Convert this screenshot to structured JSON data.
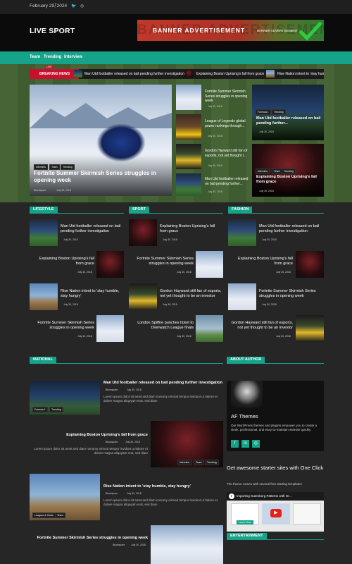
{
  "topbar": {
    "date": "February 29, 2024",
    "social_icons": [
      "facebook-icon",
      "twitter-icon",
      "instagram-icon"
    ]
  },
  "header": {
    "logo": "LIVE SPORT",
    "banner_title": "BANNER ADVERTISEMENT",
    "banner_small": "BANNER ADVERTISEMENT"
  },
  "nav": {
    "items": [
      "Team",
      "Trending",
      "Interview"
    ]
  },
  "ticker": {
    "label": "BREAKING NEWS",
    "live": "LIVE",
    "items": [
      "Man Utd footballer released on bail pending further investigation",
      "Explaining Boston Uprising's fall from grace",
      "Rise Nation intent to 'stay humble, stay hungry'"
    ]
  },
  "hero": {
    "tags": [
      "Interview",
      "Team",
      "Trending"
    ],
    "title": "Fortnite Summer Skirmish Series struggles in opening week",
    "author": "Blockspare",
    "date": "July 30, 2018"
  },
  "mid_list": [
    {
      "title": "Fortnite Summer Skirmish Series struggles in opening week",
      "date": "July 30, 2018"
    },
    {
      "title": "League of Legends global power rankings through...",
      "date": "July 30, 2018"
    },
    {
      "title": "Gordon Hayward still fan of esports, not yet thought t...",
      "date": "July 30, 2018"
    },
    {
      "title": "Man Utd footballer released on bail pending further...",
      "date": "July 30, 2018"
    }
  ],
  "right_cards": [
    {
      "tags": [
        "Formula 1",
        "Trending"
      ],
      "title": "Man Utd footballer released on bail pending further...",
      "date": "July 30, 2018"
    },
    {
      "tags": [
        "Interview",
        "Team",
        "Trending"
      ],
      "title": "Explaining Boston Uprising's fall from grace",
      "date": "July 30, 2018"
    }
  ],
  "sections": {
    "lifestyle": "LIFESTYLE",
    "sport": "SPORT",
    "fashion": "FASHION",
    "national": "NATIONAL",
    "about": "ABOUT AUTHOR",
    "entertainment": "ENTERTAINMENT"
  },
  "lifestyle": [
    {
      "title": "Man Utd footballer released on bail pending further investigation",
      "date": "July 30, 2018"
    },
    {
      "title": "Explaining Boston Uprising's fall from grace",
      "date": "July 30, 2018"
    },
    {
      "title": "Rise Nation intent to 'stay humble, stay hungry'",
      "date": "July 30, 2018"
    },
    {
      "title": "Fortnite Summer Skirmish Series struggles in opening week",
      "date": "July 30, 2018"
    }
  ],
  "sport": [
    {
      "title": "Explaining Boston Uprising's fall from grace",
      "date": "July 30, 2018"
    },
    {
      "title": "Fortnite Summer Skirmish Series struggles in opening week",
      "date": "July 30, 2018"
    },
    {
      "title": "Gordon Hayward still fan of esports, not yet thought to be an investor",
      "date": "July 30, 2018"
    },
    {
      "title": "London Spitfire punches ticket to Overwatch League finals",
      "date": "July 30, 2018"
    }
  ],
  "fashion": [
    {
      "title": "Man Utd footballer released on bail pending further investigation",
      "date": "July 30, 2018"
    },
    {
      "title": "Explaining Boston Uprising's fall from grace",
      "date": "July 30, 2018"
    },
    {
      "title": "Fortnite Summer Skirmish Series struggles in opening week",
      "date": "July 30, 2018"
    },
    {
      "title": "Gordon Hayward still fan of esports, not yet thought to be an investor",
      "date": "July 30, 2018"
    }
  ],
  "national": [
    {
      "title": "Man Utd footballer released on bail pending further investigation",
      "author": "Blockspare",
      "date": "July 30, 2018",
      "tags": [
        "Formula 1",
        "Trending"
      ],
      "excerpt": "Lorem ipsum dolor sit amet,sed diam nonumy eirmod tempor invidunt ut labore et dolore magna aliquyam erat, sed diam"
    },
    {
      "title": "Explaining Boston Uprising's fall from grace",
      "author": "Blockspare",
      "date": "July 30, 2018",
      "tags": [
        "Interview",
        "Team",
        "Trending"
      ],
      "excerpt": "Lorem ipsum dolor sit amet,sed diam nonumy eirmod tempor invidunt ut labore et dolore magna aliquyam erat, sed diam"
    },
    {
      "title": "Rise Nation intent to 'stay humble, stay hungry'",
      "author": "Blockspare",
      "date": "July 30, 2018",
      "tags": [
        "Leagues & Clubs",
        "Team"
      ],
      "excerpt": "Lorem ipsum dolor sit amet,sed diam nonumy eirmod tempor invidunt ut labore et dolore magna aliquyam erat, sed diam"
    },
    {
      "title": "Fortnite Summer Skirmish Series struggles in opening week",
      "author": "Blockspare",
      "date": "July 30, 2018"
    }
  ],
  "about": {
    "name": "AF Themes",
    "bio": "Our WordPress themes and plugins empower you to create a sleek, professional, and easy-to-maintain website quickly.",
    "social_icons": [
      "facebook-icon",
      "linkedin-icon",
      "instagram-icon"
    ]
  },
  "promo": {
    "title": "Get awesome starter sites with One Click",
    "sub": "The theme comes with several free starting templates",
    "video_title": "Importing Gutenberg Patterns with Gr...",
    "video_btn": "Learn More"
  },
  "colors": {
    "accent": "#15a38a",
    "breaking": "#c8102e",
    "bg": "#262626"
  }
}
